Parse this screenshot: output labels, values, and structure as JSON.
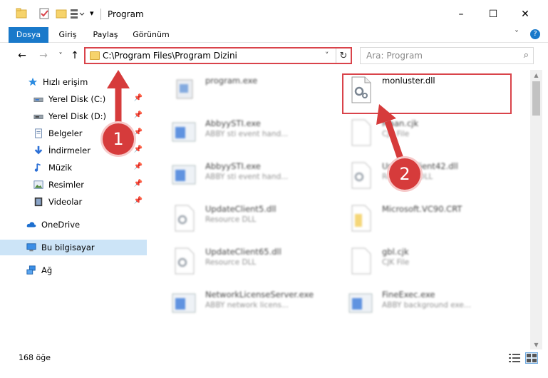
{
  "window": {
    "title": "Program",
    "controls": {
      "minimize": "–",
      "maximize": "☐",
      "close": "✕"
    }
  },
  "ribbon": {
    "tabs": [
      "Dosya",
      "Giriş",
      "Paylaş",
      "Görünüm"
    ],
    "expand_glyph": "˅",
    "help_glyph": "?"
  },
  "nav": {
    "back": "←",
    "forward": "→",
    "recent": "˅",
    "up": "↑"
  },
  "address": {
    "path": "C:\\Program Files\\Program Dizini",
    "dropdown": "˅",
    "refresh": "↻"
  },
  "search": {
    "placeholder": "Ara: Program",
    "icon": "⌕"
  },
  "sidebar": {
    "items": [
      {
        "label": "Hızlı erişim",
        "icon": "star-icon",
        "pinned": false
      },
      {
        "label": "Yerel Disk (C:)",
        "icon": "drive-icon",
        "pinned": true
      },
      {
        "label": "Yerel Disk (D:)",
        "icon": "drive-icon",
        "pinned": true
      },
      {
        "label": "Belgeler",
        "icon": "document-icon",
        "pinned": true
      },
      {
        "label": "İndirmeler",
        "icon": "download-icon",
        "pinned": true
      },
      {
        "label": "Müzik",
        "icon": "music-icon",
        "pinned": true
      },
      {
        "label": "Resimler",
        "icon": "picture-icon",
        "pinned": true
      },
      {
        "label": "Videolar",
        "icon": "video-icon",
        "pinned": true
      },
      {
        "label": "OneDrive",
        "icon": "cloud-icon",
        "pinned": false
      },
      {
        "label": "Bu bilgisayar",
        "icon": "computer-icon",
        "pinned": false
      },
      {
        "label": "Ağ",
        "icon": "network-icon",
        "pinned": false
      }
    ],
    "pin_glyph": "📌"
  },
  "files": [
    {
      "name": "program.exe",
      "desc": "",
      "icon": "exe-icon"
    },
    {
      "name": "monluster.dll",
      "desc": "",
      "icon": "dll-icon"
    },
    {
      "name": "AbbyySTI.exe",
      "desc": "ABBY sti event hand...",
      "icon": "app-icon"
    },
    {
      "name": "Maan.cjk",
      "desc": "CJK File",
      "icon": "blank-file-icon"
    },
    {
      "name": "AbbyySTI.exe",
      "desc": "ABBY sti event hand...",
      "icon": "app-icon"
    },
    {
      "name": "UpdateClient42.dll",
      "desc": "Resource DLL",
      "icon": "dll-icon"
    },
    {
      "name": "UpdateClient5.dll",
      "desc": "Resource DLL",
      "icon": "dll-icon"
    },
    {
      "name": "Microsoft.VC90.CRT",
      "desc": "",
      "icon": "folder-file-icon"
    },
    {
      "name": "UpdateClient65.dll",
      "desc": "Resource DLL",
      "icon": "dll-icon"
    },
    {
      "name": "gbl.cjk",
      "desc": "CJK File",
      "icon": "blank-file-icon"
    },
    {
      "name": "NetworkLicenseServer.exe",
      "desc": "ABBY network licens...",
      "icon": "app-icon"
    },
    {
      "name": "FineExec.exe",
      "desc": "ABBY background exe...",
      "icon": "app-icon"
    }
  ],
  "status": {
    "count": "168 öğe"
  },
  "annotations": {
    "step1": "1",
    "step2": "2"
  },
  "colors": {
    "accent": "#1979ca",
    "highlight": "#d9434a",
    "selected": "#cce4f7"
  }
}
